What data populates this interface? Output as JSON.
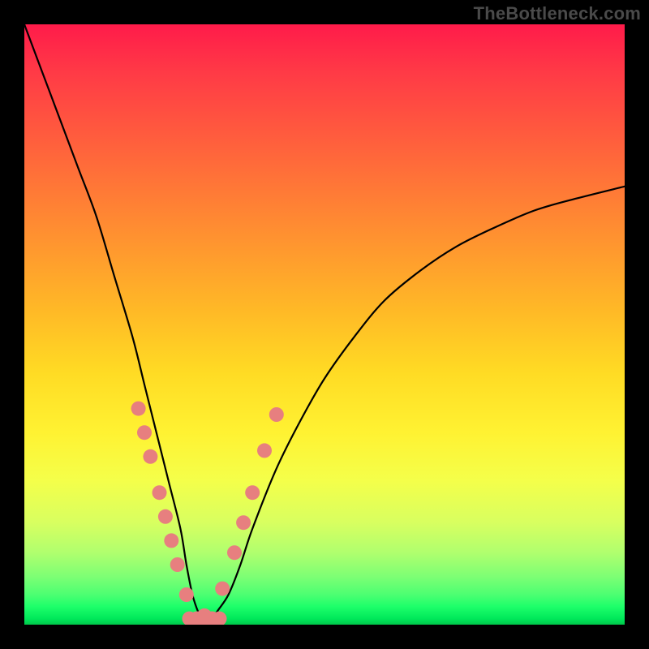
{
  "watermark": "TheBottleneck.com",
  "colors": {
    "frame": "#000000",
    "dot": "#e77f7f",
    "curve": "#000000",
    "gradient_top": "#ff1b4a",
    "gradient_bottom": "#00c84a"
  },
  "chart_data": {
    "type": "line",
    "title": "",
    "xlabel": "",
    "ylabel": "",
    "xlim": [
      0,
      100
    ],
    "ylim": [
      0,
      100
    ],
    "grid": false,
    "legend": false,
    "note": "Axes are implicit (no tick labels visible). Values are estimated percentages of the plot area: x = horizontal position, y = curve height (0 at bottom, 100 at top where the curve starts at the upper-left edge).",
    "series": [
      {
        "name": "bottleneck-curve",
        "x": [
          0,
          3,
          6,
          9,
          12,
          15,
          18,
          20,
          22,
          24,
          26,
          27,
          28,
          29,
          30,
          31,
          32,
          34,
          36,
          38,
          42,
          46,
          50,
          55,
          60,
          66,
          72,
          78,
          85,
          92,
          100
        ],
        "y": [
          100,
          92,
          84,
          76,
          68,
          58,
          48,
          40,
          32,
          24,
          16,
          10,
          5,
          2,
          0,
          0,
          2,
          5,
          10,
          16,
          26,
          34,
          41,
          48,
          54,
          59,
          63,
          66,
          69,
          71,
          73
        ]
      }
    ],
    "markers_left": [
      {
        "x": 19,
        "y": 36
      },
      {
        "x": 20,
        "y": 32
      },
      {
        "x": 21,
        "y": 28
      },
      {
        "x": 22.5,
        "y": 22
      },
      {
        "x": 23.5,
        "y": 18
      },
      {
        "x": 24.5,
        "y": 14
      },
      {
        "x": 25.5,
        "y": 10
      },
      {
        "x": 27,
        "y": 5
      }
    ],
    "markers_right": [
      {
        "x": 33,
        "y": 6
      },
      {
        "x": 35,
        "y": 12
      },
      {
        "x": 36.5,
        "y": 17
      },
      {
        "x": 38,
        "y": 22
      },
      {
        "x": 40,
        "y": 29
      },
      {
        "x": 42,
        "y": 35
      }
    ],
    "markers_bottom_pill": {
      "x_start": 27.5,
      "x_end": 32.5,
      "y": 1
    }
  }
}
